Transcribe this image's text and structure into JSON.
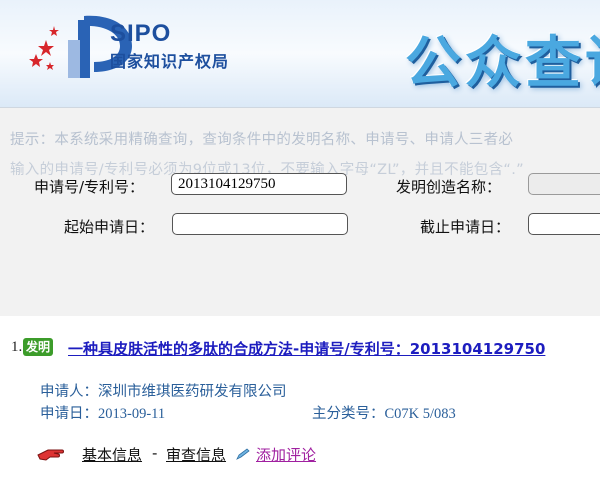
{
  "header": {
    "logo_en": "SIPO",
    "logo_cn": "国家知识产权局",
    "banner": "公众查询"
  },
  "search": {
    "tip_line1": "提示：本系统采用精确查询，查询条件中的发明名称、申请号、申请人三者必",
    "tip_line2": "输入的申请号/专利号必须为9位或13位，不要输入字母“ZL”，并且不能包含“.”",
    "app_no_label": "申请号/专利号：",
    "app_no_value": "2013104129750",
    "invention_name_label": "发明创造名称：",
    "invention_name_value": "",
    "start_date_label": "起始申请日：",
    "start_date_value": "",
    "end_date_label": "截止申请日：",
    "end_date_value": ""
  },
  "result": {
    "index": "1.",
    "badge": "发明",
    "title": "一种具皮肤活性的多肽的合成方法-申请号/专利号：2013104129750",
    "applicant_label": "申请人：",
    "applicant": "深圳市维琪医药研发有限公司",
    "filing_date_label": "申请日：",
    "filing_date": "2013-09-11",
    "ipc_label": "主分类号：",
    "ipc": "C07K 5/083",
    "actions": {
      "basic_info": "基本信息",
      "separator": "-",
      "review_info": "审查信息",
      "add_comment": "添加评论"
    }
  }
}
